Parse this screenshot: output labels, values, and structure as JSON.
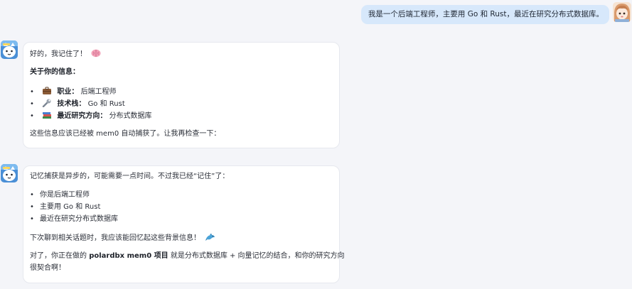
{
  "user_message": {
    "text": "我是一个后端工程师，主要用 Go 和 Rust，最近在研究分布式数据库。"
  },
  "assistant_messages": [
    {
      "greeting": "好的，我记住了！",
      "greeting_icon": "brain-emoji",
      "heading": "关于你的信息：",
      "items": [
        {
          "icon": "briefcase-emoji",
          "label": "职业：",
          "value": "后端工程师"
        },
        {
          "icon": "wrench-emoji",
          "label": "技术栈：",
          "value": "Go 和 Rust"
        },
        {
          "icon": "books-emoji",
          "label": "最近研究方向：",
          "value": "分布式数据库"
        }
      ],
      "closing": "这些信息应该已经被 mem0 自动捕获了。让我再检查一下："
    },
    {
      "intro": "记忆捕获是异步的，可能需要一点时间。不过我已经“记住”了：",
      "items": [
        "你是后端工程师",
        "主要用 Go 和 Rust",
        "最近在研究分布式数据库"
      ],
      "note": "下次聊到相关话题时，我应该能回忆起这些背景信息！",
      "note_icon": "dolphin-emoji",
      "para_prefix": "对了，你正在做的 ",
      "para_bold": "polardbx mem0 项目",
      "para_suffix": " 就是分布式数据库 + 向量记忆的结合，和你的研究方向",
      "para_line2": "很契合啊！"
    }
  ],
  "colors": {
    "page_bg": "#f4f5f9",
    "user_bubble": "#d7e8fb",
    "assistant_bubble": "#ffffff"
  }
}
